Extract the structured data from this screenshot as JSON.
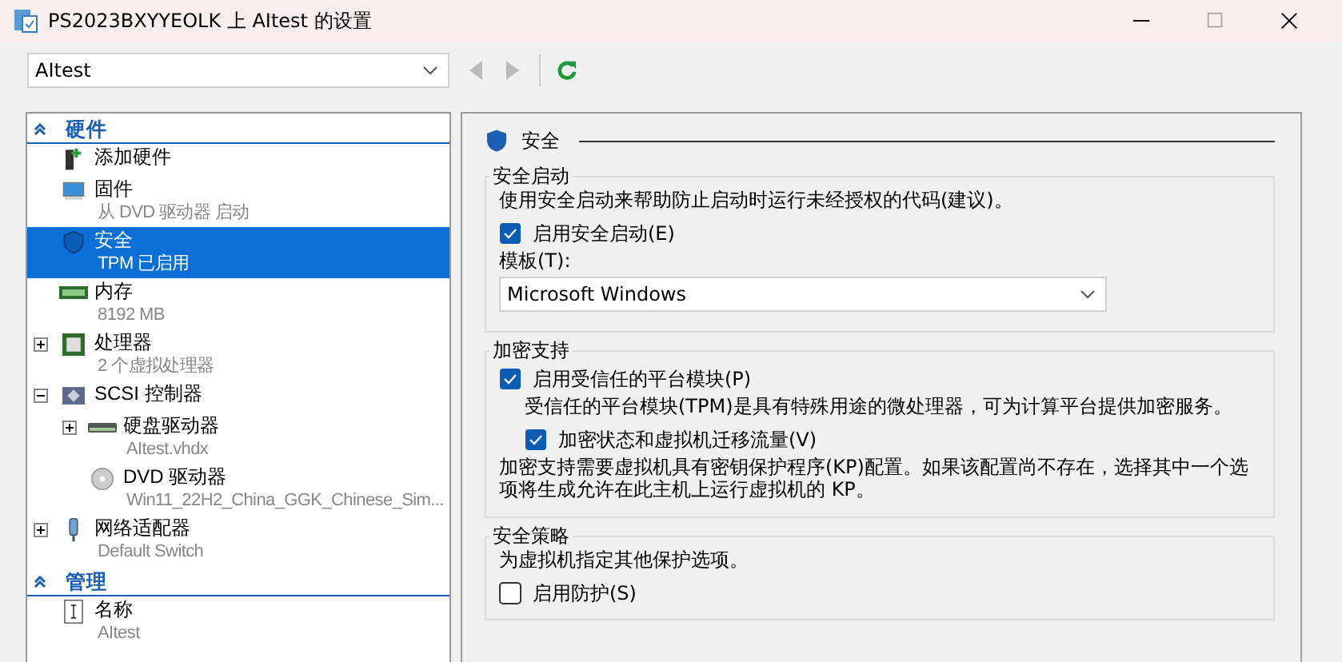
{
  "window": {
    "title": "PS2023BXYYEOLK 上 AItest 的设置"
  },
  "vm_select": {
    "value": "AItest"
  },
  "sidebar": {
    "sections": [
      {
        "title": "硬件",
        "expanded": true,
        "items": [
          {
            "kind": "add-hardware",
            "name": "添加硬件",
            "selected": false
          },
          {
            "kind": "firmware",
            "name": "固件",
            "detail": "从 DVD 驱动器 启动",
            "selected": false
          },
          {
            "kind": "security",
            "name": "安全",
            "detail": "TPM 已启用",
            "selected": true
          },
          {
            "kind": "memory",
            "name": "内存",
            "detail": "8192 MB",
            "selected": false
          },
          {
            "kind": "processor",
            "name": "处理器",
            "detail": "2 个虚拟处理器",
            "selected": false,
            "expanded": false
          },
          {
            "kind": "controller",
            "name": "SCSI 控制器",
            "selected": false,
            "expanded": true,
            "children": [
              {
                "kind": "disk",
                "name": "硬盘驱动器",
                "detail": "AItest.vhdx",
                "selected": false,
                "expanded": false
              },
              {
                "kind": "dvd",
                "name": "DVD 驱动器",
                "detail": "Win11_22H2_China_GGK_Chinese_Sim...",
                "selected": false
              }
            ]
          },
          {
            "kind": "network",
            "name": "网络适配器",
            "detail": "Default Switch",
            "selected": false,
            "expanded": false
          }
        ]
      },
      {
        "title": "管理",
        "expanded": true,
        "items": [
          {
            "kind": "name",
            "name": "名称",
            "detail": "AItest",
            "selected": false
          }
        ]
      }
    ]
  },
  "panel": {
    "title": "安全",
    "groups": [
      {
        "title": "安全启动",
        "rows": [
          {
            "kind": "text",
            "text": "使用安全启动来帮助防止启动时运行未经授权的代码(建议)。"
          },
          {
            "kind": "checkbox",
            "label": "启用安全启动(E)",
            "checked": true
          },
          {
            "kind": "label",
            "text": "模板(T):"
          },
          {
            "kind": "select",
            "value": "Microsoft Windows"
          }
        ]
      },
      {
        "title": "加密支持",
        "rows": [
          {
            "kind": "checkbox",
            "label": "启用受信任的平台模块(P)",
            "checked": true
          },
          {
            "kind": "note",
            "text": "受信任的平台模块(TPM)是具有特殊用途的微处理器，可为计算平台提供加密服务。"
          },
          {
            "kind": "subcheckbox",
            "label": "加密状态和虚拟机迁移流量(V)",
            "checked": true
          },
          {
            "kind": "text",
            "text": "加密支持需要虚拟机具有密钥保护程序(KP)配置。如果该配置尚不存在，选择其中一个选项将生成允许在此主机上运行虚拟机的 KP。"
          }
        ]
      },
      {
        "title": "安全策略",
        "rows": [
          {
            "kind": "text",
            "text": "为虚拟机指定其他保护选项。"
          },
          {
            "kind": "checkbox",
            "label": "启用防护(S)",
            "checked": false
          }
        ]
      }
    ]
  }
}
